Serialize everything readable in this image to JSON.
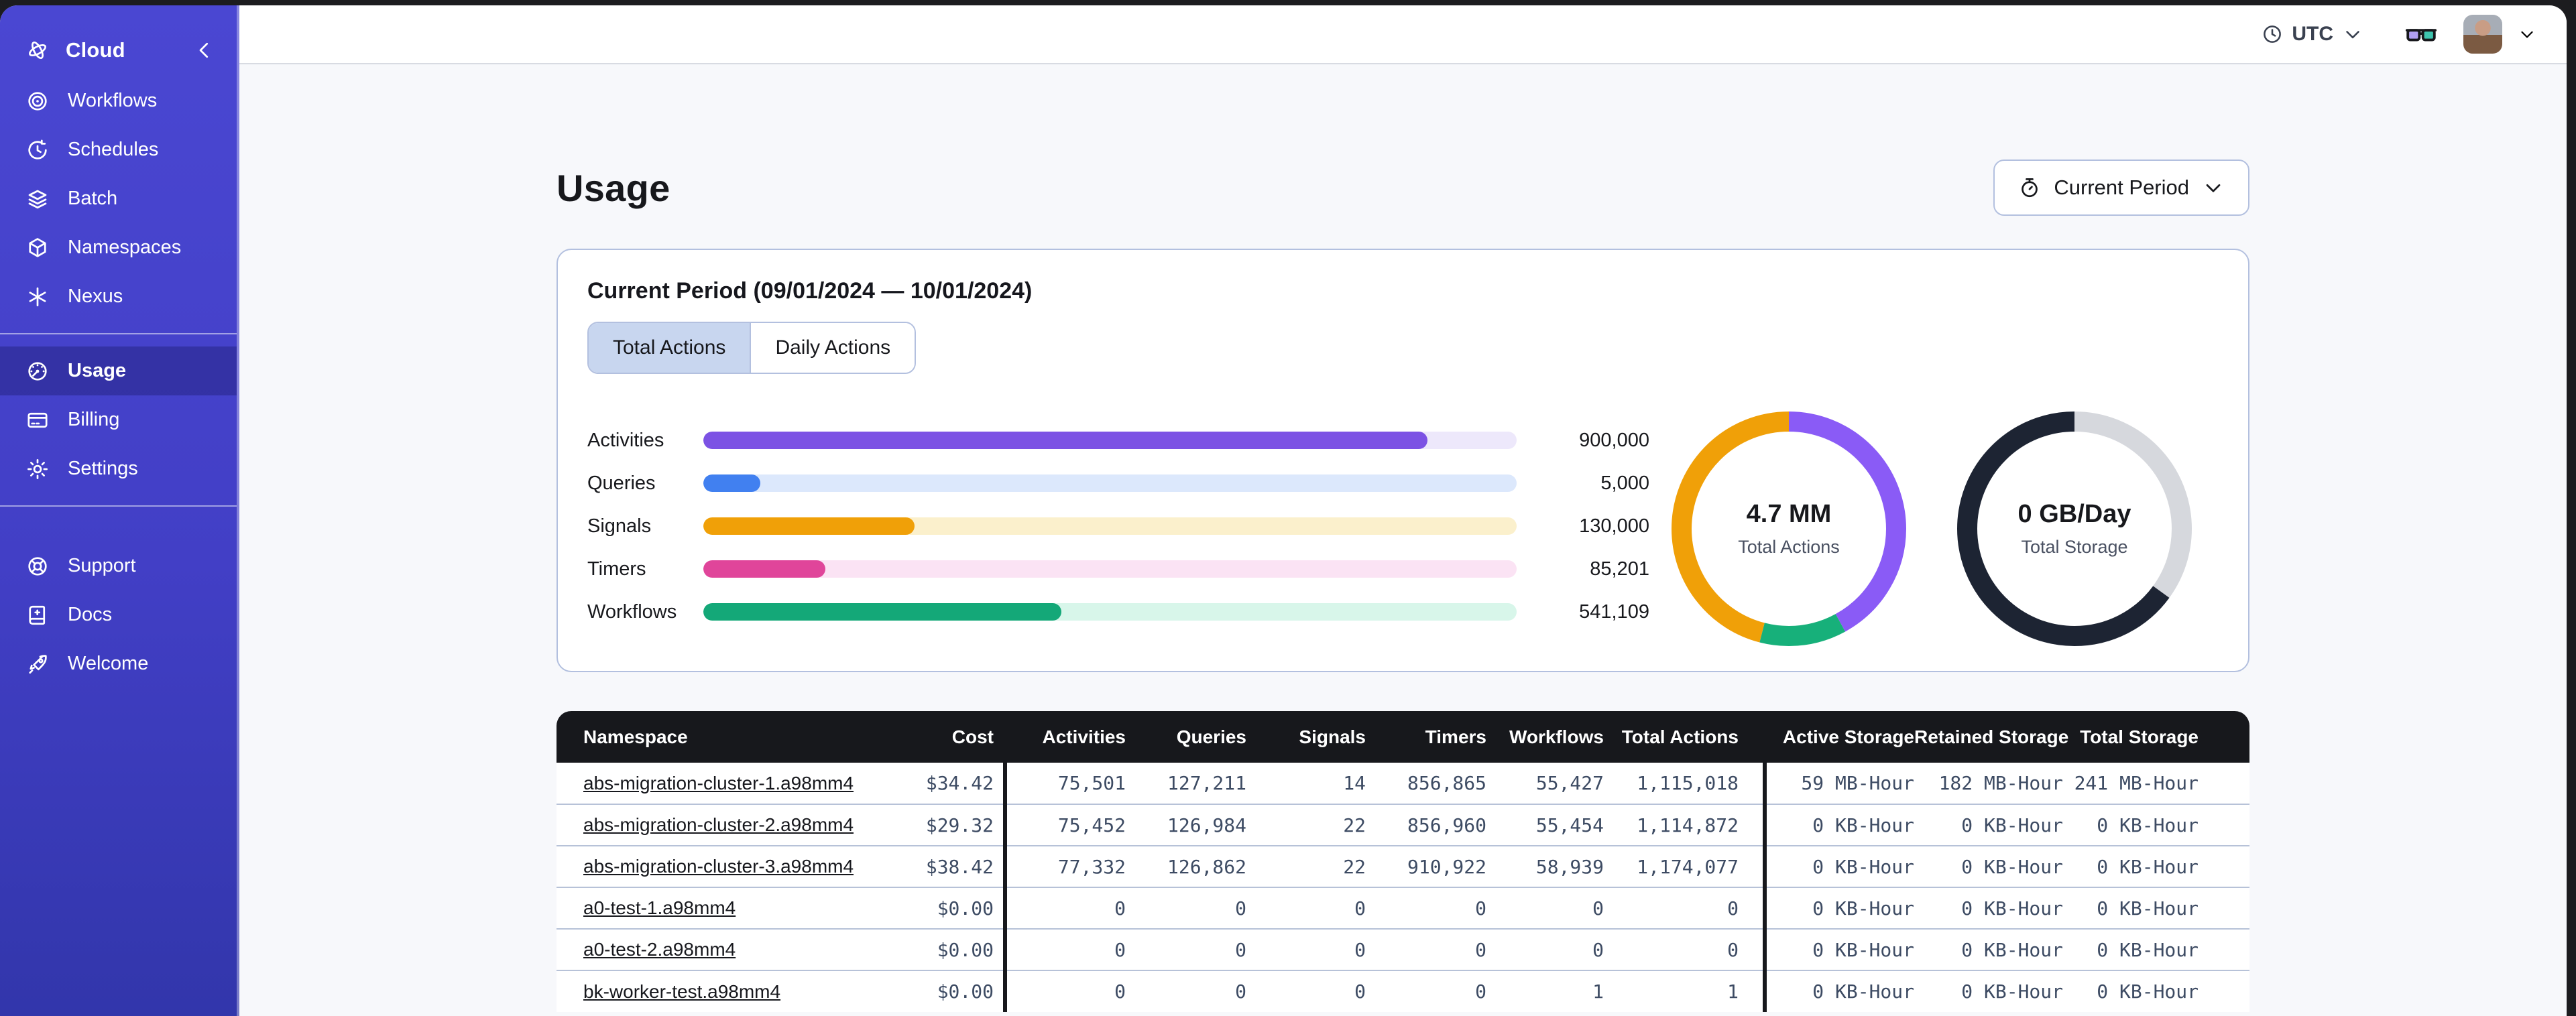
{
  "sidebar": {
    "brand": {
      "label": "Cloud",
      "icon": "temporal-logo-icon",
      "collapse_icon": "chevron-left-icon"
    },
    "nav_items": [
      {
        "label": "Workflows",
        "icon": "workflows-icon"
      },
      {
        "label": "Schedules",
        "icon": "schedules-icon"
      },
      {
        "label": "Batch",
        "icon": "batch-icon"
      },
      {
        "label": "Namespaces",
        "icon": "namespaces-icon"
      },
      {
        "label": "Nexus",
        "icon": "nexus-icon"
      }
    ],
    "account_items": [
      {
        "label": "Usage",
        "icon": "usage-icon",
        "active": true
      },
      {
        "label": "Billing",
        "icon": "billing-icon"
      },
      {
        "label": "Settings",
        "icon": "settings-icon"
      }
    ],
    "footer_items": [
      {
        "label": "Support",
        "icon": "support-icon"
      },
      {
        "label": "Docs",
        "icon": "docs-icon"
      },
      {
        "label": "Welcome",
        "icon": "welcome-icon"
      }
    ]
  },
  "topbar": {
    "timezone": "UTC"
  },
  "page": {
    "title": "Usage",
    "period_button_label": "Current Period"
  },
  "usage_card": {
    "title": "Current Period (09/01/2024 — 10/01/2024)",
    "tabs": [
      {
        "label": "Total Actions",
        "active": true
      },
      {
        "label": "Daily Actions",
        "active": false
      }
    ]
  },
  "chart_data": [
    {
      "type": "bar",
      "orientation": "horizontal",
      "categories": [
        "Activities",
        "Queries",
        "Signals",
        "Timers",
        "Workflows"
      ],
      "values": [
        900000,
        5000,
        130000,
        85201,
        541109
      ],
      "display_values": [
        "900,000",
        "5,000",
        "130,000",
        "85,201",
        "541,109"
      ],
      "fill_percent": [
        89,
        7,
        26,
        15,
        44
      ],
      "bar_colors": [
        "#7C52E4",
        "#4180F0",
        "#F0A008",
        "#E0459A",
        "#14A878"
      ],
      "track_colors": [
        "#EDE8FB",
        "#DCE8FC",
        "#FBF0CC",
        "#FBE3F4",
        "#D8F6EA"
      ]
    },
    {
      "type": "donut",
      "label": "4.7 MM",
      "sublabel": "Total Actions",
      "segments": [
        {
          "name": "purple",
          "color": "#8A5BF6",
          "percent": 42
        },
        {
          "name": "green",
          "color": "#17B07A",
          "percent": 12
        },
        {
          "name": "orange",
          "color": "#F0A008",
          "percent": 46
        }
      ]
    },
    {
      "type": "donut",
      "label": "0 GB/Day",
      "sublabel": "Total Storage",
      "segments": [
        {
          "name": "light-gray",
          "color": "#D6D8DD",
          "percent": 35
        },
        {
          "name": "dark-navy",
          "color": "#1D2433",
          "percent": 65
        }
      ]
    }
  ],
  "namespace_table": {
    "columns": [
      {
        "key": "namespace",
        "label": "Namespace"
      },
      {
        "key": "cost",
        "label": "Cost"
      },
      {
        "key": "activities",
        "label": "Activities"
      },
      {
        "key": "queries",
        "label": "Queries"
      },
      {
        "key": "signals",
        "label": "Signals"
      },
      {
        "key": "timers",
        "label": "Timers"
      },
      {
        "key": "workflows",
        "label": "Workflows"
      },
      {
        "key": "total_actions",
        "label": "Total Actions"
      },
      {
        "key": "active_storage",
        "label": "Active Storage"
      },
      {
        "key": "retained_storage",
        "label": "Retained Storage"
      },
      {
        "key": "total_storage",
        "label": "Total Storage"
      }
    ],
    "rows": [
      {
        "namespace": "abs-migration-cluster-1.a98mm4",
        "cost": "$34.42",
        "activities": "75,501",
        "queries": "127,211",
        "signals": "14",
        "timers": "856,865",
        "workflows": "55,427",
        "total_actions": "1,115,018",
        "active_storage": "59 MB-Hour",
        "retained_storage": "182 MB-Hour",
        "total_storage": "241 MB-Hour"
      },
      {
        "namespace": "abs-migration-cluster-2.a98mm4",
        "cost": "$29.32",
        "activities": "75,452",
        "queries": "126,984",
        "signals": "22",
        "timers": "856,960",
        "workflows": "55,454",
        "total_actions": "1,114,872",
        "active_storage": "0 KB-Hour",
        "retained_storage": "0 KB-Hour",
        "total_storage": "0 KB-Hour"
      },
      {
        "namespace": "abs-migration-cluster-3.a98mm4",
        "cost": "$38.42",
        "activities": "77,332",
        "queries": "126,862",
        "signals": "22",
        "timers": "910,922",
        "workflows": "58,939",
        "total_actions": "1,174,077",
        "active_storage": "0 KB-Hour",
        "retained_storage": "0 KB-Hour",
        "total_storage": "0 KB-Hour"
      },
      {
        "namespace": "a0-test-1.a98mm4",
        "cost": "$0.00",
        "activities": "0",
        "queries": "0",
        "signals": "0",
        "timers": "0",
        "workflows": "0",
        "total_actions": "0",
        "active_storage": "0 KB-Hour",
        "retained_storage": "0 KB-Hour",
        "total_storage": "0 KB-Hour"
      },
      {
        "namespace": "a0-test-2.a98mm4",
        "cost": "$0.00",
        "activities": "0",
        "queries": "0",
        "signals": "0",
        "timers": "0",
        "workflows": "0",
        "total_actions": "0",
        "active_storage": "0 KB-Hour",
        "retained_storage": "0 KB-Hour",
        "total_storage": "0 KB-Hour"
      },
      {
        "namespace": "bk-worker-test.a98mm4",
        "cost": "$0.00",
        "activities": "0",
        "queries": "0",
        "signals": "0",
        "timers": "0",
        "workflows": "1",
        "total_actions": "1",
        "active_storage": "0 KB-Hour",
        "retained_storage": "0 KB-Hour",
        "total_storage": "0 KB-Hour"
      }
    ]
  }
}
